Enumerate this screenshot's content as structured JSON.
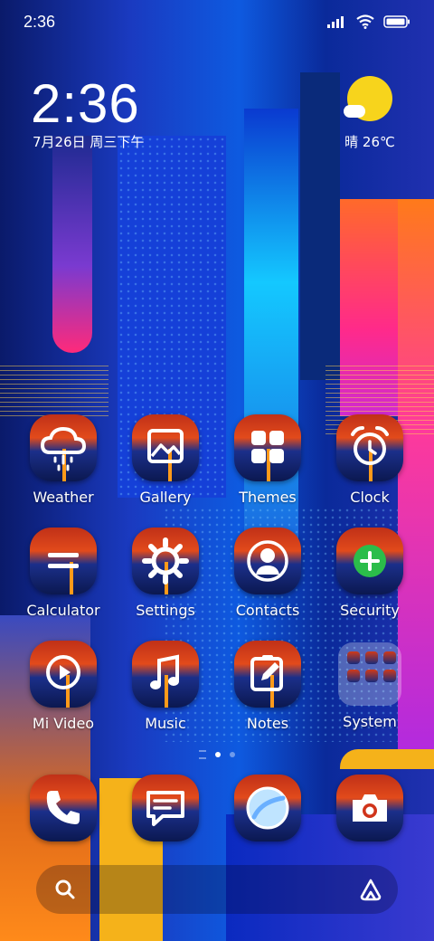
{
  "status_bar": {
    "time": "2:36"
  },
  "clock_widget": {
    "time": "2:36",
    "date": "7月26日 周三下午"
  },
  "weather_widget": {
    "temperature": "晴 26℃",
    "icon": "sun-cloud-icon"
  },
  "apps": [
    {
      "label": "Weather",
      "icon": "cloud-rain-icon"
    },
    {
      "label": "Gallery",
      "icon": "image-icon"
    },
    {
      "label": "Themes",
      "icon": "grid-squares-icon"
    },
    {
      "label": "Clock",
      "icon": "alarm-clock-icon"
    },
    {
      "label": "Calculator",
      "icon": "equals-icon"
    },
    {
      "label": "Settings",
      "icon": "gear-icon"
    },
    {
      "label": "Contacts",
      "icon": "person-icon"
    },
    {
      "label": "Security",
      "icon": "plus-shield-icon"
    },
    {
      "label": "Mi Video",
      "icon": "play-icon"
    },
    {
      "label": "Music",
      "icon": "music-note-icon"
    },
    {
      "label": "Notes",
      "icon": "pencil-note-icon"
    },
    {
      "label": "System",
      "icon": "folder-icon"
    }
  ],
  "dock": [
    {
      "name": "Phone",
      "icon": "phone-icon"
    },
    {
      "name": "Messaging",
      "icon": "message-icon"
    },
    {
      "name": "Browser",
      "icon": "browser-icon"
    },
    {
      "name": "Camera",
      "icon": "camera-icon"
    }
  ],
  "pager": {
    "pages": 2,
    "current": 1
  },
  "search_bar": {
    "search_icon": "search-icon",
    "assistant_icon": "assistant-icon"
  }
}
